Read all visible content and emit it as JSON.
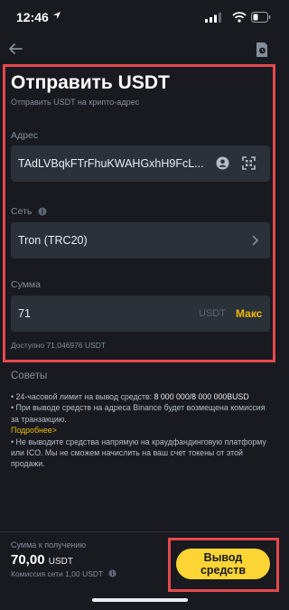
{
  "status_bar": {
    "time": "12:46"
  },
  "header": {
    "title": "Отправить USDT",
    "subtitle": "Отправить USDT на крипто-адрес"
  },
  "address": {
    "label": "Адрес",
    "value": "TAdLVBqkFTrFhuKWAHGxhH9FcL..."
  },
  "network": {
    "label": "Сеть",
    "value": "Tron (TRC20)"
  },
  "amount": {
    "label": "Сумма",
    "value": "71",
    "unit": "USDT",
    "max_label": "Макс",
    "available": "Доступно  71,046976 USDT"
  },
  "tips": {
    "title": "Советы",
    "line1_prefix": "• 24-часовой лимит на вывод средств: ",
    "line1_value": "8 000 000/8 000 000BUSD",
    "line2": "• При выводе средств на адреса Binance будет возмещена комиссия за транзакцию.",
    "more": "Подробнее>",
    "line3": "• Не выводите средства напрямую на краудфандинговую платформу или ICO. Мы не сможем начислить на ваш счет токены от этой продажи."
  },
  "footer": {
    "receive_label": "Сумма к получению",
    "receive_amount": "70,00",
    "receive_unit": "USDT",
    "fee": "Комиссия сети 1,00 USDT",
    "withdraw_label": "Вывод средств"
  },
  "colors": {
    "accent": "#F0B90B",
    "button": "#FCD535",
    "background": "#181A20",
    "field": "#2B3139",
    "highlight_border": "#E5484D"
  }
}
